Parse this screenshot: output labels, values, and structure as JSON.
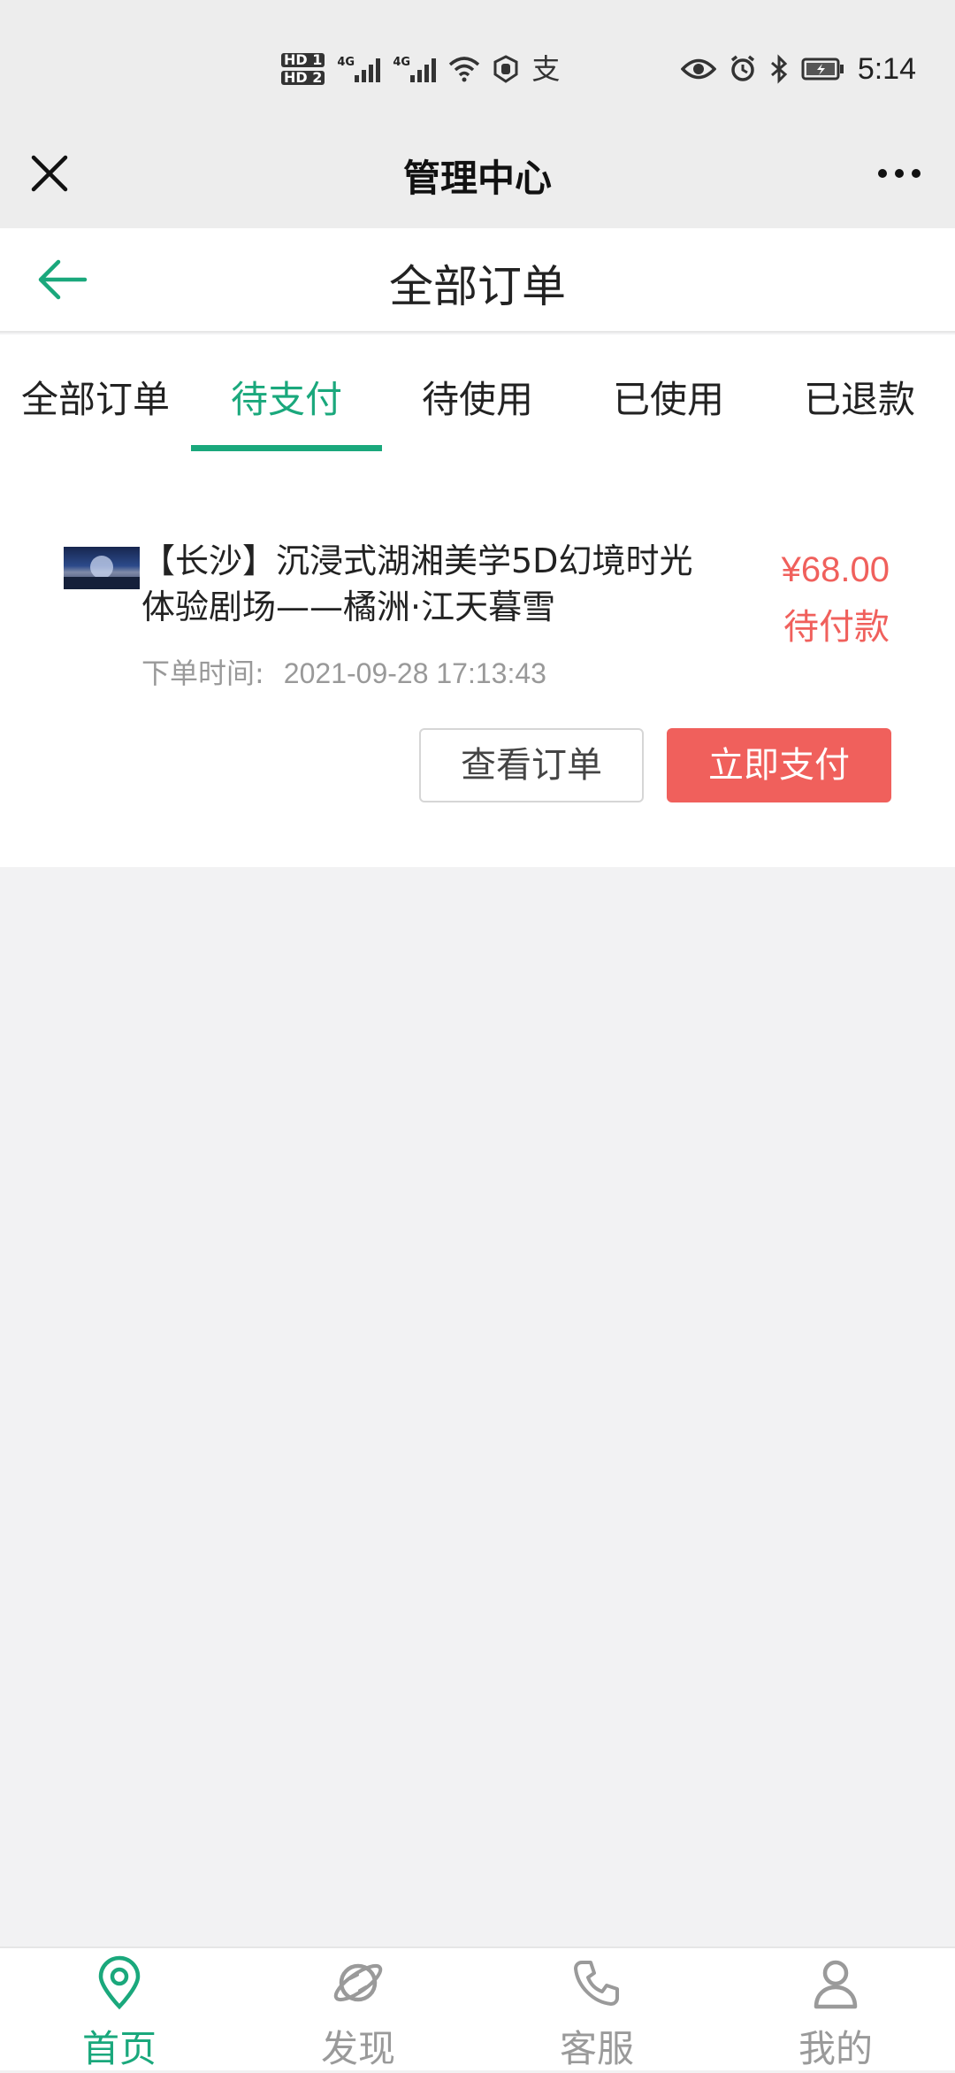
{
  "status_bar": {
    "hd_top": "HD 1",
    "hd_bottom": "HD 2",
    "net1": "4G",
    "net2": "4G",
    "time": "5:14"
  },
  "miniprogram_header": {
    "title": "管理中心",
    "close_icon": "close-icon",
    "more_icon": "more-icon"
  },
  "page_nav": {
    "title": "全部订单",
    "back_icon": "arrow-left-icon",
    "accent_color": "#1aa87c"
  },
  "tabs": [
    {
      "label": "全部订单",
      "active": false
    },
    {
      "label": "待支付",
      "active": true
    },
    {
      "label": "待使用",
      "active": false
    },
    {
      "label": "已使用",
      "active": false
    },
    {
      "label": "已退款",
      "active": false
    }
  ],
  "order": {
    "title": "【长沙】沉浸式湖湘美学5D幻境时光体验剧场——橘洲·江天暮雪",
    "price": "¥68.00",
    "status": "待付款",
    "time_label": "下单时间:",
    "time_value": "2021-09-28 17:13:43",
    "view_button": "查看订单",
    "pay_button": "立即支付",
    "price_color": "#f0605c"
  },
  "bottom_nav": [
    {
      "label": "首页",
      "icon": "location-pin-icon",
      "active": true
    },
    {
      "label": "发现",
      "icon": "planet-icon",
      "active": false
    },
    {
      "label": "客服",
      "icon": "phone-icon",
      "active": false
    },
    {
      "label": "我的",
      "icon": "user-icon",
      "active": false
    }
  ]
}
